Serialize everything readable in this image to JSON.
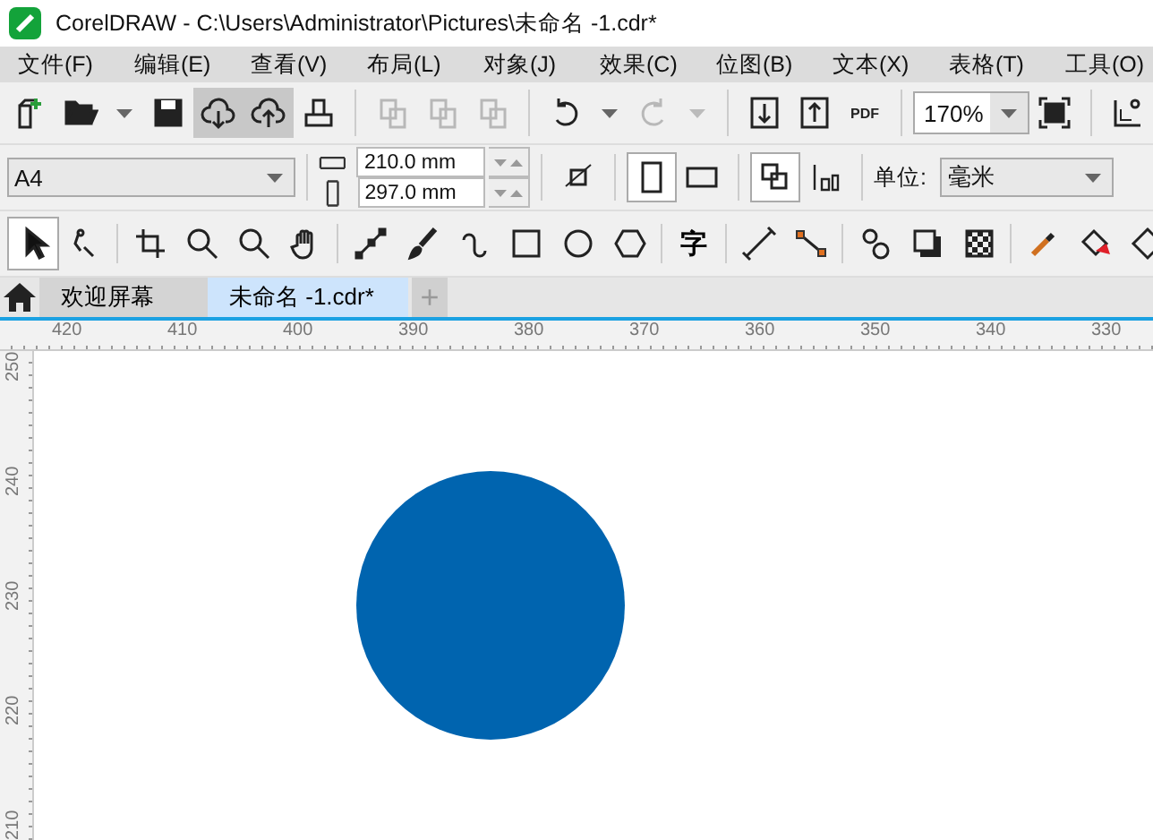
{
  "window": {
    "title": "CorelDRAW - C:\\Users\\Administrator\\Pictures\\未命名 -1.cdr*"
  },
  "menu": [
    "文件(F)",
    "编辑(E)",
    "查看(V)",
    "布局(L)",
    "对象(J)",
    "效果(C)",
    "位图(B)",
    "文本(X)",
    "表格(T)",
    "工具(O)"
  ],
  "toolbar": [
    {
      "kind": "new",
      "pressed": false,
      "disabled": false
    },
    {
      "kind": "open",
      "pressed": false,
      "disabled": false
    },
    {
      "kind": "save",
      "pressed": false,
      "disabled": false
    },
    {
      "kind": "cloud-down",
      "pressed": true,
      "disabled": false
    },
    {
      "kind": "cloud-up",
      "pressed": true,
      "disabled": false
    },
    {
      "kind": "print",
      "pressed": false,
      "disabled": false
    },
    {
      "kind": "sep"
    },
    {
      "kind": "cut",
      "pressed": false,
      "disabled": true
    },
    {
      "kind": "copy",
      "pressed": false,
      "disabled": true
    },
    {
      "kind": "paste",
      "pressed": false,
      "disabled": true
    },
    {
      "kind": "sep"
    },
    {
      "kind": "undo",
      "pressed": false,
      "disabled": false
    },
    {
      "kind": "redo",
      "pressed": false,
      "disabled": true
    },
    {
      "kind": "sep"
    },
    {
      "kind": "import",
      "pressed": false,
      "disabled": false
    },
    {
      "kind": "export",
      "pressed": false,
      "disabled": false
    },
    {
      "kind": "pdf",
      "label": "PDF",
      "pressed": false,
      "disabled": false
    },
    {
      "kind": "sep"
    },
    {
      "kind": "zoom",
      "value": "170%"
    },
    {
      "kind": "fullscreen",
      "pressed": false,
      "disabled": false
    },
    {
      "kind": "sep"
    },
    {
      "kind": "options",
      "pressed": false,
      "disabled": false
    }
  ],
  "property_bar": {
    "page_size": "A4",
    "width": "210.0 mm",
    "height": "297.0 mm",
    "portrait_selected": true,
    "units_label": "单位:",
    "units": "毫米"
  },
  "toolbox": [
    {
      "kind": "pick",
      "selected": true
    },
    {
      "kind": "shape",
      "selected": false
    },
    {
      "kind": "sep"
    },
    {
      "kind": "crop",
      "selected": false
    },
    {
      "kind": "zoom",
      "selected": false
    },
    {
      "kind": "zoom-out",
      "selected": false
    },
    {
      "kind": "pan",
      "selected": false
    },
    {
      "kind": "sep"
    },
    {
      "kind": "line",
      "selected": false
    },
    {
      "kind": "brush",
      "selected": false
    },
    {
      "kind": "curve",
      "selected": false
    },
    {
      "kind": "rect",
      "selected": false
    },
    {
      "kind": "ellipse",
      "selected": false
    },
    {
      "kind": "polygon",
      "selected": false
    },
    {
      "kind": "sep"
    },
    {
      "kind": "text",
      "label": "字",
      "selected": false
    },
    {
      "kind": "sep"
    },
    {
      "kind": "dimension",
      "selected": false
    },
    {
      "kind": "connector",
      "selected": false
    },
    {
      "kind": "sep"
    },
    {
      "kind": "blend",
      "selected": false
    },
    {
      "kind": "shadow",
      "selected": false
    },
    {
      "kind": "transparency",
      "selected": false
    },
    {
      "kind": "sep"
    },
    {
      "kind": "eyedropper",
      "selected": false
    },
    {
      "kind": "fill",
      "selected": false
    },
    {
      "kind": "outline",
      "selected": false
    }
  ],
  "tabs": [
    {
      "label": "欢迎屏幕",
      "selected": false
    },
    {
      "label": "未命名 -1.cdr*",
      "selected": true
    }
  ],
  "new_tab": "+",
  "ruler_h": [
    "420",
    "410",
    "400",
    "390",
    "380",
    "370",
    "360",
    "350",
    "340",
    "330"
  ],
  "ruler_v": [
    "250",
    "240",
    "230",
    "220",
    "210"
  ]
}
